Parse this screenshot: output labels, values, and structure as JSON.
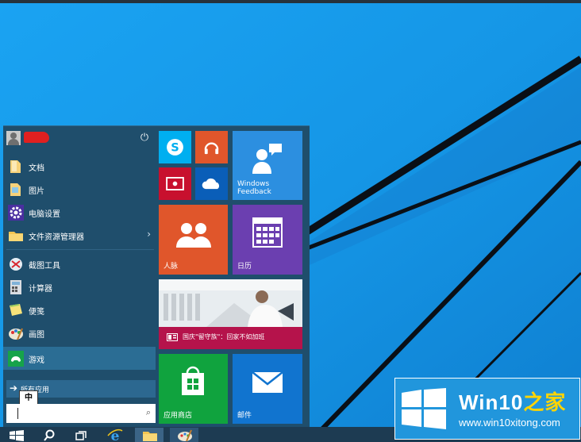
{
  "start_menu": {
    "power_icon": "power-icon",
    "items": [
      {
        "label": "文档",
        "icon": "documents-folder-icon"
      },
      {
        "label": "图片",
        "icon": "pictures-folder-icon"
      },
      {
        "label": "电脑设置",
        "icon": "settings-gear-icon"
      },
      {
        "label": "文件资源管理器",
        "icon": "file-explorer-icon"
      },
      {
        "label": "截图工具",
        "icon": "snipping-tool-icon"
      },
      {
        "label": "计算器",
        "icon": "calculator-icon"
      },
      {
        "label": "便笺",
        "icon": "sticky-notes-icon"
      },
      {
        "label": "画图",
        "icon": "paint-icon"
      },
      {
        "label": "游戏",
        "icon": "games-icon"
      }
    ],
    "all_apps_label": "所有应用",
    "ime_label": "中"
  },
  "tiles": {
    "skype": {
      "color": "#00aff0",
      "icon": "skype-icon"
    },
    "music": {
      "color": "#e0562b",
      "icon": "headphones-icon"
    },
    "video": {
      "color": "#c8102e",
      "icon": "video-icon"
    },
    "onedrive": {
      "color": "#0a5eb8",
      "icon": "cloud-icon"
    },
    "feedback": {
      "label": "Windows\nFeedback",
      "color": "#2c8fe0",
      "icon": "feedback-icon"
    },
    "people": {
      "label": "人脉",
      "color": "#e0562b",
      "icon": "people-icon"
    },
    "calendar": {
      "label": "日历",
      "color": "#6b3fb0",
      "icon": "calendar-icon"
    },
    "news": {
      "headline": "国庆\"留守族\"：回家不如加班",
      "color": "#b5134b",
      "icon": "news-icon"
    },
    "store": {
      "label": "应用商店",
      "color": "#10a33e",
      "icon": "store-icon"
    },
    "mail": {
      "label": "邮件",
      "color": "#1174cf",
      "icon": "mail-icon"
    }
  },
  "taskbar": {
    "items": [
      "start-button-icon",
      "search-icon",
      "task-view-icon",
      "internet-explorer-icon",
      "file-explorer-icon",
      "paint-icon"
    ]
  },
  "watermark": {
    "brand_prefix": "Win10",
    "brand_suffix": "之家",
    "url": "www.win10xitong.com"
  }
}
